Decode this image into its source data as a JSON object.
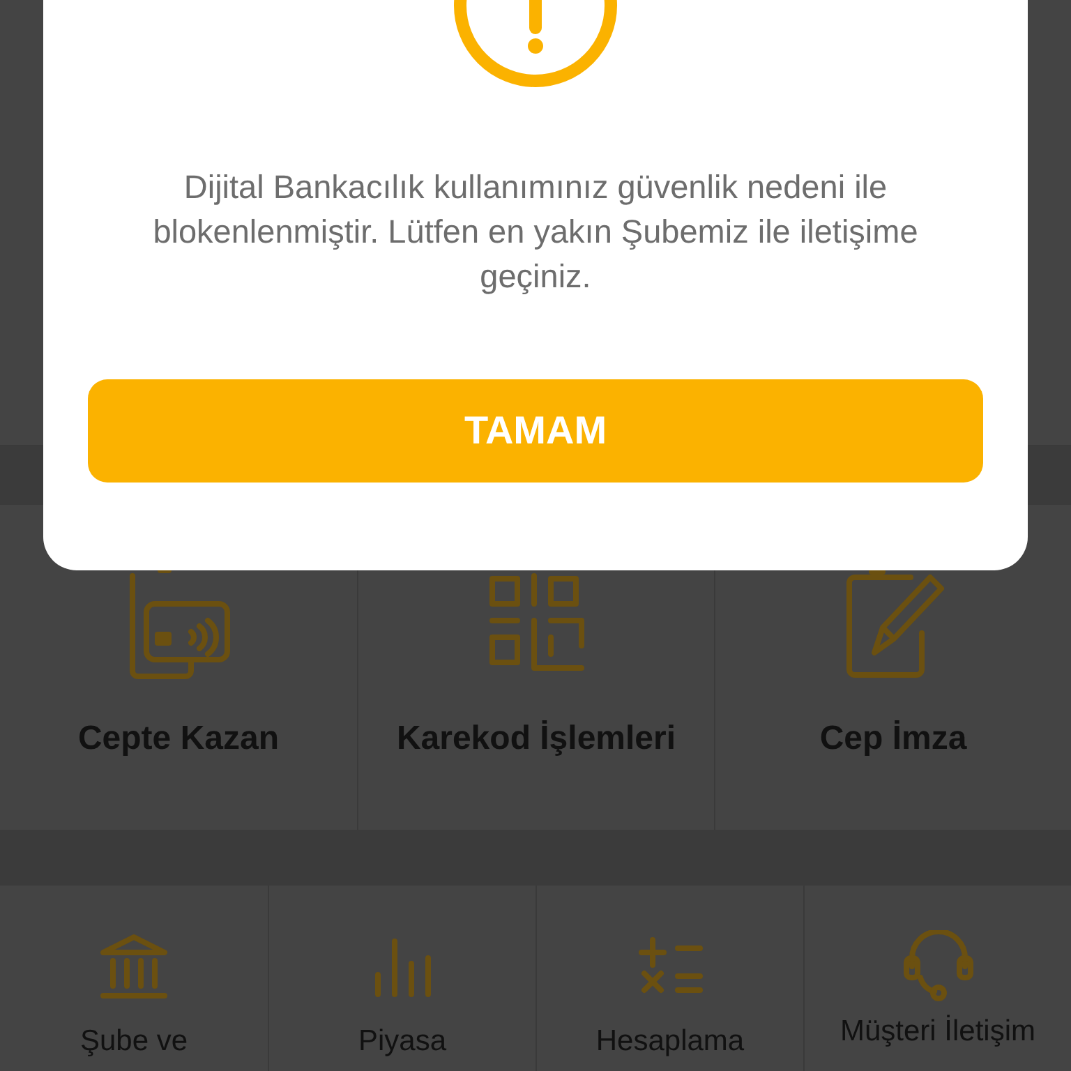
{
  "dialog": {
    "message": "Dijital Bankacılık kullanımınız güvenlik nedeni ile blokenlenmiştir. Lütfen en yakın Şubemiz ile iletişime geçiniz.",
    "button": "TAMAM"
  },
  "quick_actions": [
    {
      "kind": "wallet",
      "label": "Cepte Kazan"
    },
    {
      "kind": "qr",
      "label": "Karekod İşlemleri"
    },
    {
      "kind": "sign",
      "label": "Cep İmza"
    }
  ],
  "shortcuts": [
    {
      "kind": "bank",
      "label": "Şube ve"
    },
    {
      "kind": "chart",
      "label": "Piyasa"
    },
    {
      "kind": "calc",
      "label": "Hesaplama"
    },
    {
      "kind": "support",
      "label": "Müşteri İletişim"
    }
  ]
}
